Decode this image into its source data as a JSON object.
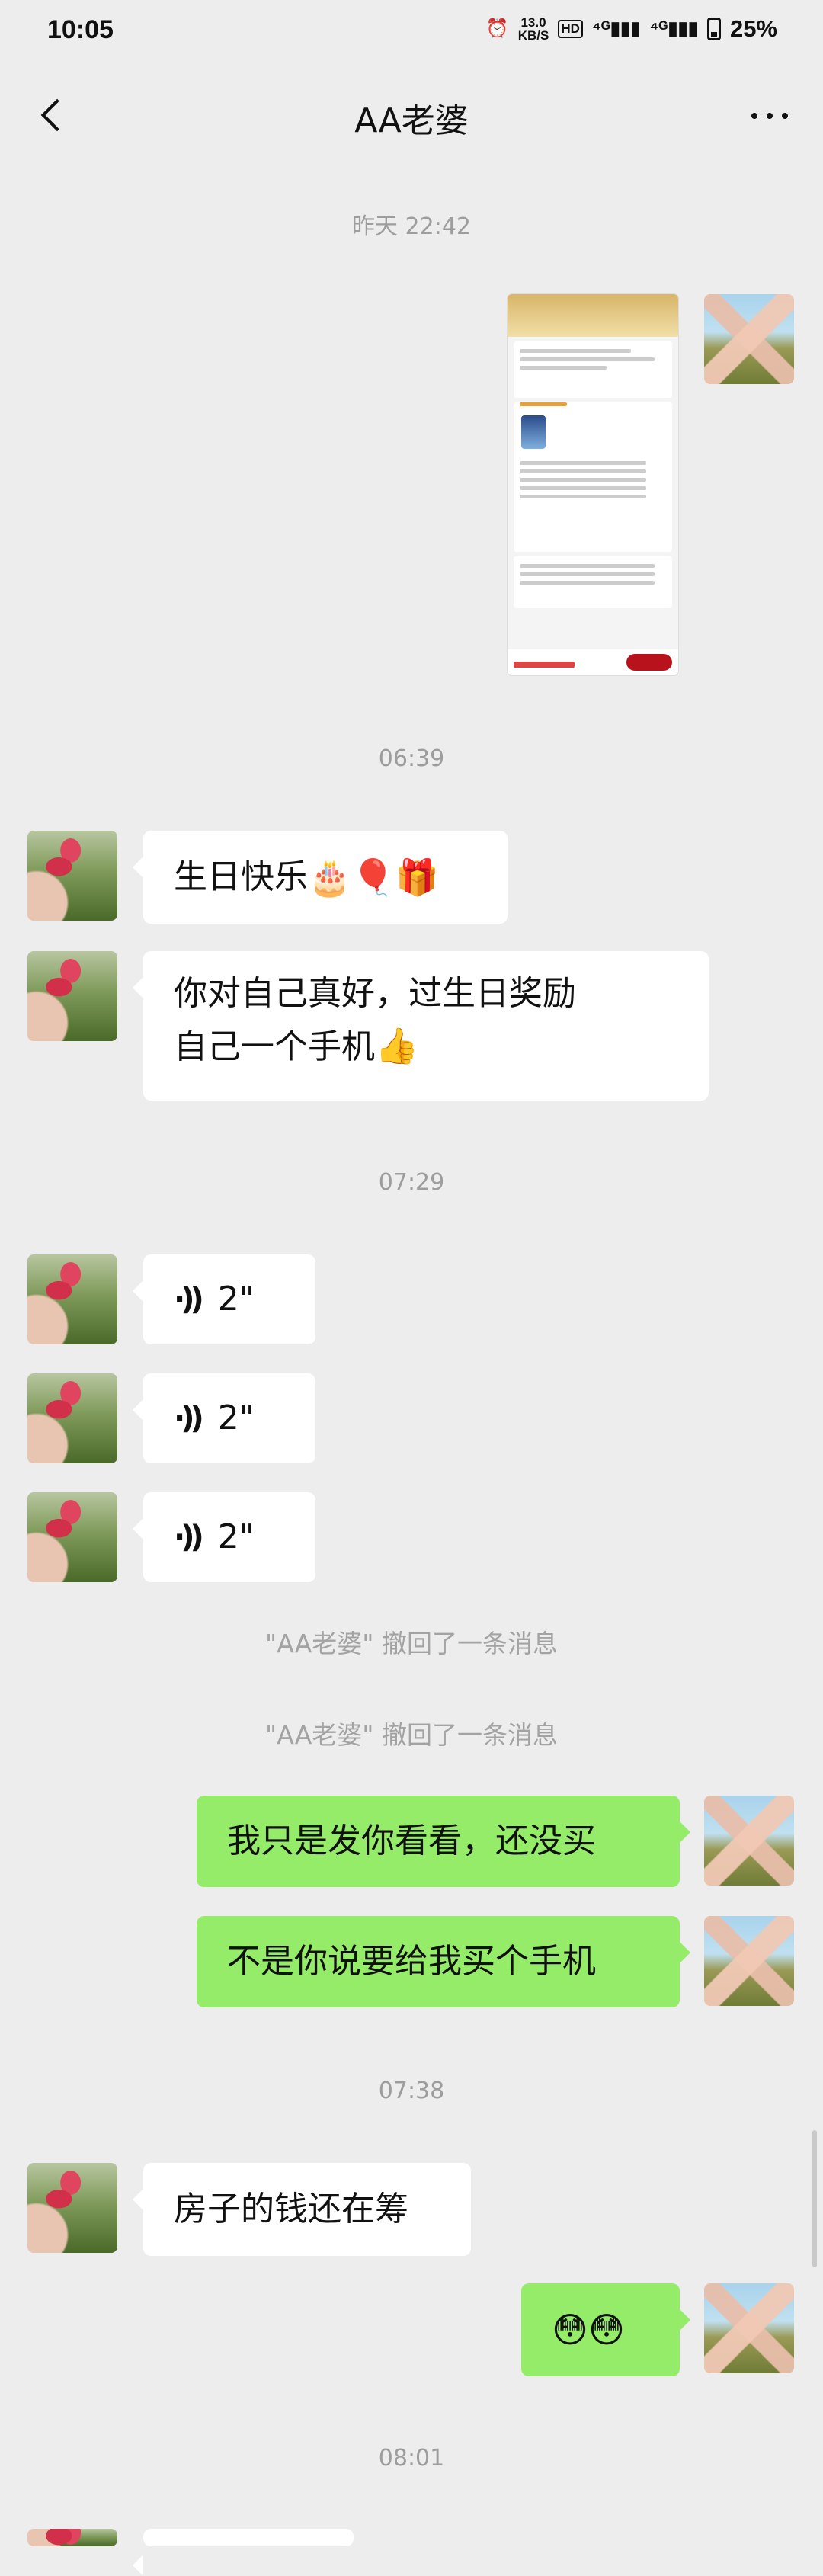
{
  "status_bar": {
    "time": "10:05",
    "speed_value": "13.0",
    "speed_unit": "KB/S",
    "hd": "HD",
    "sig1": "⁴ᴳ▮▮▮",
    "sig2": "⁴ᴳ▮▮▮",
    "alarm_icon": "⏰",
    "battery_percent": "25%"
  },
  "title_bar": {
    "title": "AA老婆"
  },
  "messages": {
    "ts1": "昨天 22:42",
    "ts2": "06:39",
    "m_birthday_text": "生日快乐",
    "m_birthday_emoji": "🎂🎈🎁",
    "m_self_line1": "你对自己真好，过生日奖励",
    "m_self_line2": "自己一个手机",
    "m_self_emoji": "👍",
    "ts3": "07:29",
    "voice_duration": "2\"",
    "recall1": "\"AA老婆\" 撤回了一条消息",
    "recall2": "\"AA老婆\" 撤回了一条消息",
    "m_just_show": "我只是发你看看，还没买",
    "m_you_said": "不是你说要给我买个手机",
    "ts4": "07:38",
    "m_house": "房子的钱还在筹",
    "m_flushed": "😳😳",
    "ts5": "08:01"
  },
  "colors": {
    "background": "#ededed",
    "sent_bubble": "#95ec69",
    "received_bubble": "#ffffff"
  }
}
